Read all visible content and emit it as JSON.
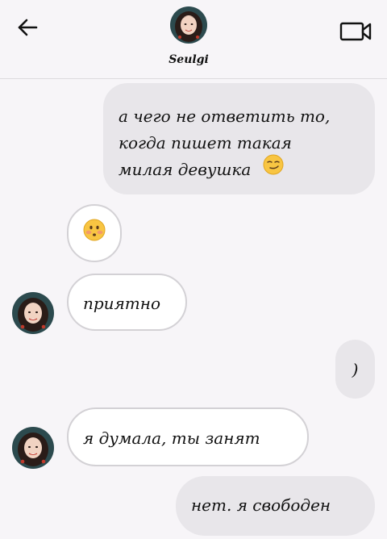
{
  "header": {
    "contact_name": "Seulgi",
    "back_icon": "arrow-left-icon",
    "video_icon": "video-camera-icon"
  },
  "messages": [
    {
      "direction": "out",
      "lines": [
        "а чего не ответить то,",
        "когда пишет такая",
        "милая девушка"
      ],
      "emoji": "smirk"
    },
    {
      "direction": "in",
      "text": "",
      "emoji": "flushed"
    },
    {
      "direction": "in",
      "text": "приятно"
    },
    {
      "direction": "out",
      "text": ")"
    },
    {
      "direction": "in",
      "text": "я думала, ты занят"
    },
    {
      "direction": "out",
      "text": "нет. я свободен"
    }
  ],
  "colors": {
    "background": "#f7f5f8",
    "outgoing_bubble": "#e8e6ea",
    "incoming_bubble": "#ffffff",
    "incoming_border": "#d3d1d5"
  }
}
